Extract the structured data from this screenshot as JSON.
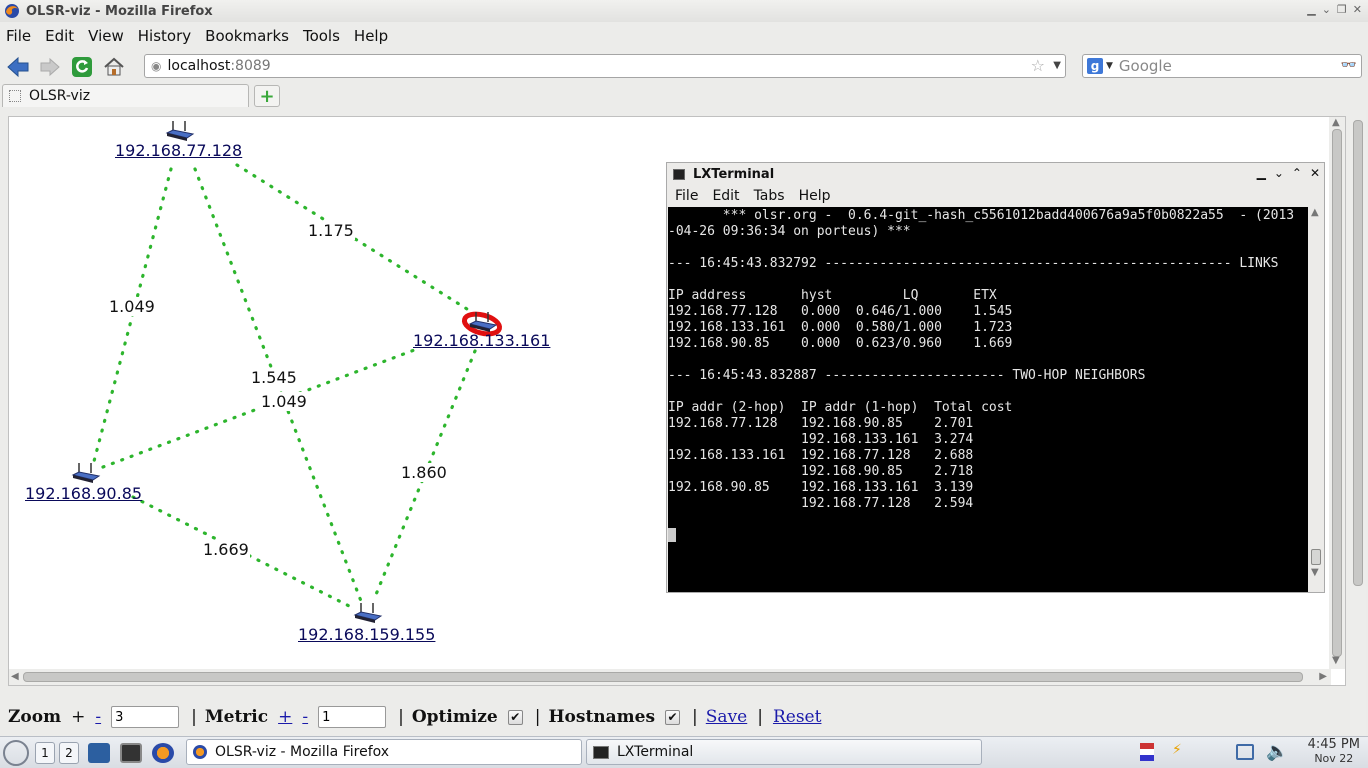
{
  "window": {
    "title": "OLSR-viz - Mozilla Firefox"
  },
  "menubar": {
    "items": [
      "File",
      "Edit",
      "View",
      "History",
      "Bookmarks",
      "Tools",
      "Help"
    ]
  },
  "navbar": {
    "url_host": "localhost",
    "url_port": ":8089",
    "search_placeholder": "Google",
    "search_engine_letter": "g"
  },
  "tabs": [
    {
      "label": "OLSR-viz"
    }
  ],
  "graph": {
    "nodes": [
      {
        "id": "n77",
        "label": "192.168.77.128",
        "selected": false
      },
      {
        "id": "n133",
        "label": "192.168.133.161",
        "selected": true
      },
      {
        "id": "n90",
        "label": "192.168.90.85",
        "selected": false
      },
      {
        "id": "n159",
        "label": "192.168.159.155",
        "selected": false
      }
    ],
    "edges": [
      {
        "from": "n77",
        "to": "n133",
        "label": "1.175"
      },
      {
        "from": "n77",
        "to": "n90",
        "label": "1.049"
      },
      {
        "from": "n77",
        "to": "n159",
        "label": "1.545"
      },
      {
        "from": "n90",
        "to": "n133",
        "label": "1.049"
      },
      {
        "from": "n133",
        "to": "n159",
        "label": "1.860"
      },
      {
        "from": "n90",
        "to": "n159",
        "label": "1.669"
      }
    ],
    "edge_color": "#2db52d"
  },
  "terminal": {
    "title": "LXTerminal",
    "menu": [
      "File",
      "Edit",
      "Tabs",
      "Help"
    ],
    "lines": [
      "       *** olsr.org -  0.6.4-git_-hash_c5561012badd400676a9a5f0b0822a55  - (2013",
      "-04-26 09:36:34 on porteus) ***",
      "",
      "--- 16:45:43.832792 ---------------------------------------------------- LINKS",
      "",
      "IP address       hyst         LQ       ETX",
      "192.168.77.128   0.000  0.646/1.000    1.545",
      "192.168.133.161  0.000  0.580/1.000    1.723",
      "192.168.90.85    0.000  0.623/0.960    1.669",
      "",
      "--- 16:45:43.832887 ----------------------- TWO-HOP NEIGHBORS",
      "",
      "IP addr (2-hop)  IP addr (1-hop)  Total cost",
      "192.168.77.128   192.168.90.85    2.701",
      "                 192.168.133.161  3.274",
      "192.168.133.161  192.168.77.128   2.688",
      "                 192.168.90.85    2.718",
      "192.168.90.85    192.168.133.161  3.139",
      "                 192.168.77.128   2.594"
    ]
  },
  "controls": {
    "zoom_label": "Zoom",
    "zoom_plus": "+",
    "zoom_minus": "-",
    "zoom_value": "3",
    "sep": "|",
    "metric_label": "Metric",
    "metric_plus": "+",
    "metric_minus": "-",
    "metric_value": "1",
    "optimize_label": "Optimize",
    "optimize_checked": true,
    "hostnames_label": "Hostnames",
    "hostnames_checked": true,
    "save_label": "Save",
    "reset_label": "Reset"
  },
  "taskbar": {
    "desktops": [
      "1",
      "2"
    ],
    "tasks": [
      {
        "label": "OLSR-viz - Mozilla Firefox"
      },
      {
        "label": "LXTerminal"
      }
    ],
    "time": "4:45 PM",
    "date": "Nov 22"
  }
}
